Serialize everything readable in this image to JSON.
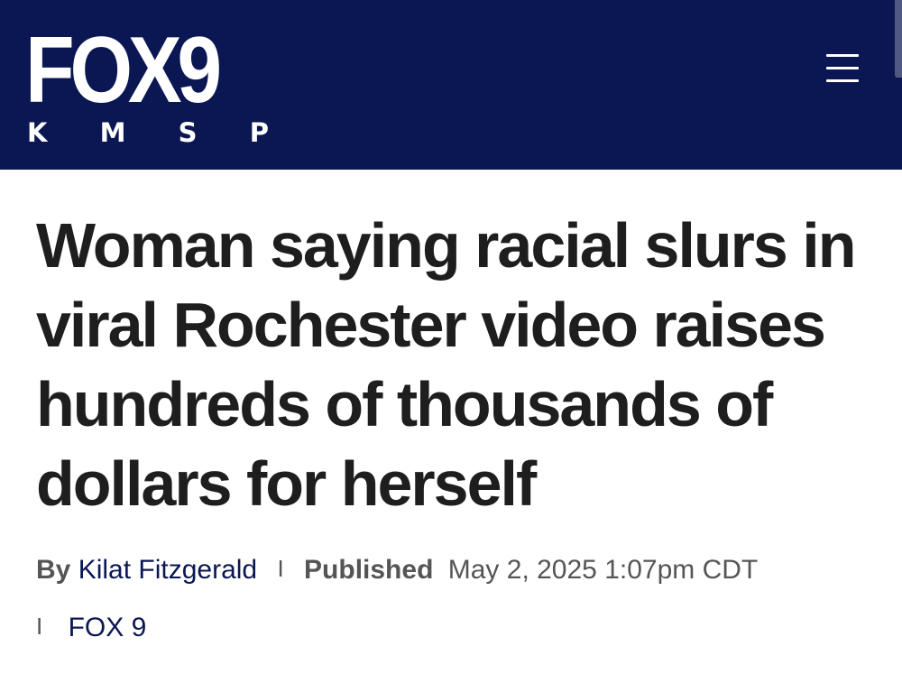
{
  "header": {
    "logo_main": "FOX9",
    "logo_sub": [
      "K",
      "M",
      "S",
      "P"
    ],
    "background_color": "#0a1752",
    "menu_icon": "hamburger-menu-icon"
  },
  "article": {
    "headline": "Woman saying racial slurs in viral Rochester video raises hundreds of thousands of dollars for herself",
    "by_label": "By",
    "author": "Kilat Fitzgerald",
    "separator": "I",
    "published_label": "Published",
    "published_date": "May 2, 2025 1:07pm CDT",
    "source": "FOX 9"
  },
  "colors": {
    "headline_text": "#1e1e1e",
    "meta_text": "#555555",
    "link_text": "#0a1752"
  }
}
